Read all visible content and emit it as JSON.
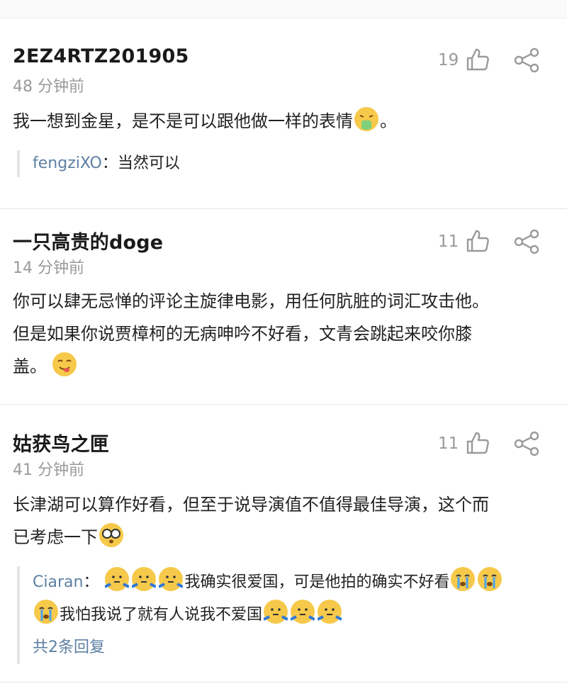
{
  "colors": {
    "accent_link": "#5d7fa3",
    "meta_gray": "#9a9a9a",
    "divider": "#e6e6e6"
  },
  "comments": [
    {
      "username": "2EZ4RTZ201905",
      "time": "48 分钟前",
      "likes": "19",
      "text": "我一想到金星，是不是可以跟他做一样的表情",
      "text_end": "。",
      "emoji": "vomit-face-icon",
      "reply": {
        "user": "fengziXO",
        "sep": "：",
        "text": "当然可以"
      }
    },
    {
      "username": "一只高贵的doge",
      "time": "14 分钟前",
      "likes": "11",
      "text_line1": "你可以肆无忌惮的评论主旋律电影，用任何肮脏的词汇攻击他。",
      "text_line2": "但是如果你说贾樟柯的无病呻吟不好看，文青会跳起来咬你膝",
      "text_line3": "盖。",
      "emoji": "yummy-face-icon"
    },
    {
      "username": "姑获鸟之匣",
      "time": "41 分钟前",
      "likes": "11",
      "text_line1": "长津湖可以算作好看，但至于说导演值不值得最佳导演，这个而",
      "text_line2": "已考虑一下",
      "emoji": "glasses-face-icon",
      "reply": {
        "user": "Ciaran",
        "sep": "：",
        "text1": "我确实很爱国，可是他拍的确实不好看",
        "text2": "我怕我说了就有人说我不爱国",
        "more": "共2条回复"
      }
    }
  ]
}
